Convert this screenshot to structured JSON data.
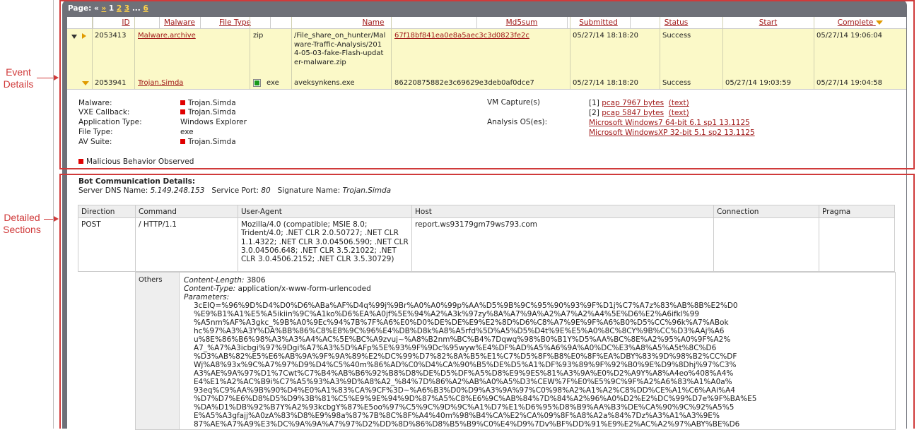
{
  "annotations": {
    "event_details": [
      "Event",
      "Details"
    ],
    "detailed_sections": [
      "Detailed",
      "Sections"
    ]
  },
  "pagination": {
    "label": "Page:",
    "first": "«",
    "next": "»",
    "pages": [
      "1",
      "2",
      "3"
    ],
    "ellipsis": "...",
    "last": "6"
  },
  "events_table": {
    "columns": [
      "ID",
      "Malware",
      "File Type",
      "Name",
      "Md5sum",
      "Submitted",
      "Status",
      "Start",
      "Complete"
    ],
    "rows": [
      {
        "id": "2053413",
        "malware": "Malware.archive",
        "file_type": "zip",
        "name": "/File_share_on_hunter/Malware-Traffic-Analysis/2014-05-03-fake-Flash-updater-malware.zip",
        "md5": "67f18bf841ea0e8a5aec3c3d0823fe2c",
        "submitted": "05/27/14 18:18:20",
        "status": "Success",
        "start": "",
        "complete": "05/27/14 19:06:04"
      },
      {
        "id": "2053941",
        "malware": "Trojan.Simda",
        "file_type": "exe",
        "name": "aveksynkens.exe",
        "md5": "86220875882e3c69629e3deb0af0dce7",
        "submitted": "05/27/14 18:18:20",
        "status": "Success",
        "start": "05/27/14 19:03:59",
        "complete": "05/27/14 19:04:58"
      }
    ]
  },
  "details": {
    "malware_label": "Malware:",
    "malware_value": "Trojan.Simda",
    "vxe_label": "VXE Callback:",
    "vxe_value": "Trojan.Simda",
    "app_type_label": "Application Type:",
    "app_type_value": "Windows Explorer",
    "file_type_label": "File Type:",
    "file_type_value": "exe",
    "av_suite_label": "AV Suite:",
    "av_suite_value": "Trojan.Simda",
    "malicious": "Malicious Behavior Observed",
    "vm_capture_label": "VM Capture(s)",
    "captures": [
      {
        "index": "[1]",
        "link": "pcap 7967 bytes",
        "text": "(text)"
      },
      {
        "index": "[2]",
        "link": "pcap 5847 bytes",
        "text": "(text)"
      }
    ],
    "analysis_os_label": "Analysis OS(es):",
    "os": [
      "Microsoft Windows7 64-bit 6.1 sp1 13.1125",
      "Microsoft WindowsXP 32-bit 5.1 sp2 13.1125"
    ]
  },
  "bot": {
    "title": "Bot Communication Details:",
    "dns_label": "Server DNS Name:",
    "dns_value": "5.149.248.153",
    "port_label": "Service Port:",
    "port_value": "80",
    "sig_label": "Signature Name:",
    "sig_value": "Trojan.Simda",
    "columns": [
      "Direction",
      "Command",
      "User-Agent",
      "Host",
      "Connection",
      "Pragma"
    ],
    "row": {
      "direction": "POST",
      "command": "/ HTTP/1.1",
      "user_agent": "Mozilla/4.0 (compatible; MSIE 8.0; Trident/4.0; .NET CLR 2.0.50727; .NET CLR 1.1.4322; .NET CLR 3.0.04506.590; .NET CLR 3.0.04506.648; .NET CLR 3.5.21022; .NET CLR 3.0.4506.2152; .NET CLR 3.5.30729)",
      "host": "report.ws93179gm79ws793.com",
      "connection": "",
      "pragma": ""
    },
    "others_label": "Others",
    "content_length_label": "Content-Length:",
    "content_length_value": "3806",
    "content_type_label": "Content-Type:",
    "content_type_value": "application/x-www-form-urlencoded",
    "parameters_label": "Parameters:",
    "parameters_lines": [
      "3cEIQ=%96%9D%D4%D0%D6%ABa%AF%D4q%99j%9Br%A0%A0%99p%AA%D5%9B%9C%95%90%93%9F%D1j%C7%A7z%83%AB%8B%E2%D0",
      "%E9%B1%A1%E5%A5ikiin%9C%A1ko%D6%EA%A0jf%5E%94%A2%A3k%97zy%8A%A7%9A%A2%A7%A2%A4%5E%D6%E2%A6ifkl%99",
      "%A5nm%AF%A3gkc_%9B%A0%9Ec%94%7B%7F%A6%E0%D0%DE%DE%E9%E2%8D%D6%C8%A7%9E%9F%A6%B0%D5%CC%96k%A7%ABok",
      "hc%97%A3%A3Y%DA%BB%86%C8%E8%9C%96%E4%DB%D8k%A8%A5rfd%5D%A5%D5%D4t%9E%E5%A0%8C%8CY%9B%CC%D3%AAj%A6",
      "u%8E%86%B6%98%A3%A3%A4%AC%5E%BC%A9zvuj~%A8%B2nm%BC%B4%7Dqwq%98%B0%B1Y%D5%AA%BC%8E%A2%95%A0%9F%A2%",
      "A7_%A7%A3icbgi%97%9Dgi%A7%A3%5D%AFp%5E%93%9F%9Dc%95wyw%E4%DF%AD%A5%A6%9A%A0%DC%E3%A8%A5%A5t%8C%D6",
      "%D3%AB%82%E5%E6%AB%9A%9F%9A%89%E2%DC%99%D7%82%8A%B5%E1%C7%D5%8F%B8%E0%8F%EA%DBY%83%9D%98%B2%CC%DF",
      "Wj%A8%93x%9C%A7%97%D9%D4%C5%40m%86%AD%C0%D4%CA%90%B5%DE%D5%A1%DF%93%89%9F%92%B0%9E%D9%8Dhj%97%C3%",
      "A3%AE%9A%97%D1%7Cwt%C7%B4%AB%B6%92%B8%D8%DE%D5%DF%A5%D8%E9%9ES%81%A3%9A%E0%D2%A9Y%A8%A4eo%408%A4%",
      "E4%E1%A2%AC%B9i%C7%A5%93%A3%9D%A8%A2_%84%7D%86%A2%AB%A0%A5%D3%CEW%7F%E0%E5%9C%9F%A2%A6%83%A1%A0a%",
      "93eq%C9%AA%9B%90%D4%E0%A1%83%CA%9CF%3D~%A6%B3%D0%D9%A3%9A%97%C0%98%A2%A1%A2%C8%DD%CE%A1%C6%AAi%A4",
      "%D7%D7%E6%D8%D5%D9%3B%81%C5%E9%9E%94%9D%87%A5%C8%E6%9C%AB%84%7D%84%A2%96%A0%D2%E2%DC%99%D7e%9F%BA%E5",
      "%DA%D1%DB%92%B7Y%A2%93kcbgY%87%E5oo%97%C5%9C%9D%9C%A1%D7%E1%D6%95%D8%B9%AA%B3%DE%CA%90%9C%92%A5%5",
      "E%A5%A3gfajj%A0zA%83%D8%E9%98a%87%7B%8C%8F%A4%40m%98%B4%CA%E2%CA%09%8F%A8%A2a%84%7Dz%A3%A1%A3%9E%",
      "87%AE%A7%A9%E3%DC%9A%9A%A7%97%D2%DD%8D%86%D8%B5%B9%C0%E4%D9%7Dv%BF%DD%91%E9%E2%AC%A2%97%ABY%BE%D6"
    ]
  }
}
